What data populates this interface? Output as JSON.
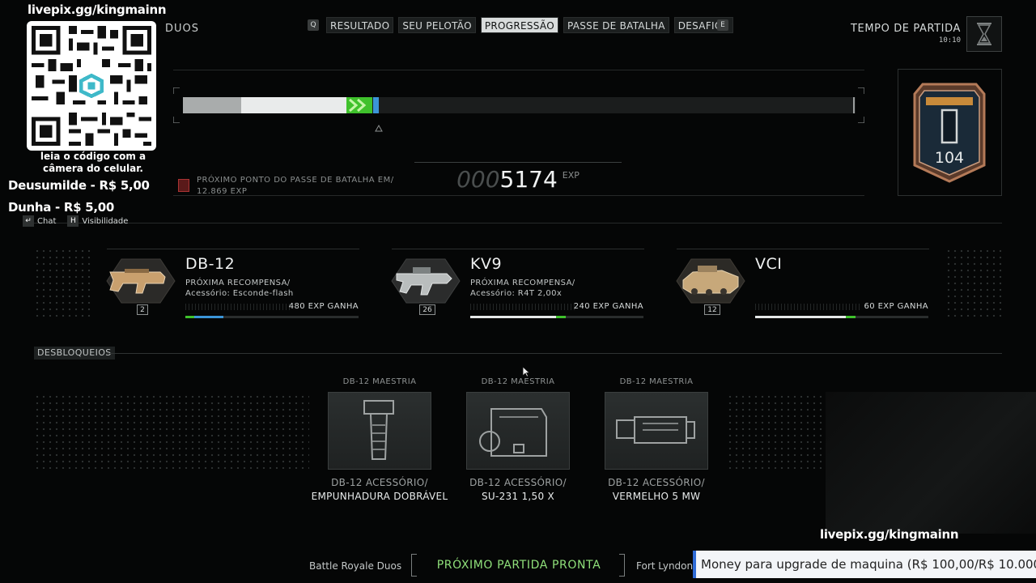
{
  "header": {
    "mode": "DUOS",
    "key_left": "Q",
    "key_right": "E",
    "tabs": [
      {
        "label": "RESULTADO",
        "active": false
      },
      {
        "label": "SEU PELOTÃO",
        "active": false
      },
      {
        "label": "PROGRESSÃO",
        "active": true
      },
      {
        "label": "PASSE DE BATALHA",
        "active": false
      },
      {
        "label": "DESAFIOS",
        "active": false
      }
    ],
    "timer_label": "TEMPO DE PARTIDA",
    "timer_value": "10:10"
  },
  "progress": {
    "next_point_label": "PRÓXIMO PONTO DO PASSE DE BATALHA EM/",
    "next_point_exp": "12.869 EXP",
    "exp_padding": "000",
    "exp_value": "5174",
    "exp_unit": "EXP",
    "rank": "104"
  },
  "weapons": [
    {
      "name": "DB-12",
      "level": "2",
      "next_label": "PRÓXIMA RECOMPENSA/",
      "next_reward": "Acessório: Esconde-flash",
      "exp_gained": "480 EXP GANHA"
    },
    {
      "name": "KV9",
      "level": "26",
      "next_label": "PRÓXIMA RECOMPENSA/",
      "next_reward": "Acessório: R4T 2,00x",
      "exp_gained": "240 EXP GANHA"
    },
    {
      "name": "VCI",
      "level": "12",
      "next_label": "",
      "next_reward": "",
      "exp_gained": "60 EXP GANHA"
    }
  ],
  "unlocks_section": "DESBLOQUEIOS",
  "unlocks": [
    {
      "title": "DB-12 MAESTRIA",
      "category": "DB-12 ACESSÓRIO/",
      "name": "EMPUNHADURA DOBRÁVEL",
      "icon": "foregrip-icon"
    },
    {
      "title": "DB-12 MAESTRIA",
      "category": "DB-12 ACESSÓRIO/",
      "name": "SU-231 1,50 X",
      "icon": "holo-sight-icon"
    },
    {
      "title": "DB-12 MAESTRIA",
      "category": "DB-12 ACESSÓRIO/",
      "name": "VERMELHO 5 MW",
      "icon": "laser-icon"
    }
  ],
  "overlay": {
    "livepix_top": "livepix.gg/kingmainn",
    "qr_caption": "leia o código com a câmera do celular.",
    "donations": [
      "Deusumilde - R$ 5,00",
      "Dunha - R$ 5,00"
    ],
    "hint_chat_key": "↵",
    "hint_chat": "Chat",
    "hint_vis_key": "H",
    "hint_vis": "Visibilidade",
    "livepix_bottom": "livepix.gg/kingmainn",
    "goal_text": "Money para upgrade de maquina (R$ 100,00/R$ 10.000"
  },
  "footer": {
    "mode": "Battle Royale Duos",
    "status": "PRÓXIMO PARTIDA PRONTA",
    "map": "Fort Lyndon"
  },
  "colors": {
    "accent_green": "#3fc12c",
    "accent_blue": "#3b95d8",
    "ready_green": "#8fe07a",
    "background": "#050606"
  }
}
